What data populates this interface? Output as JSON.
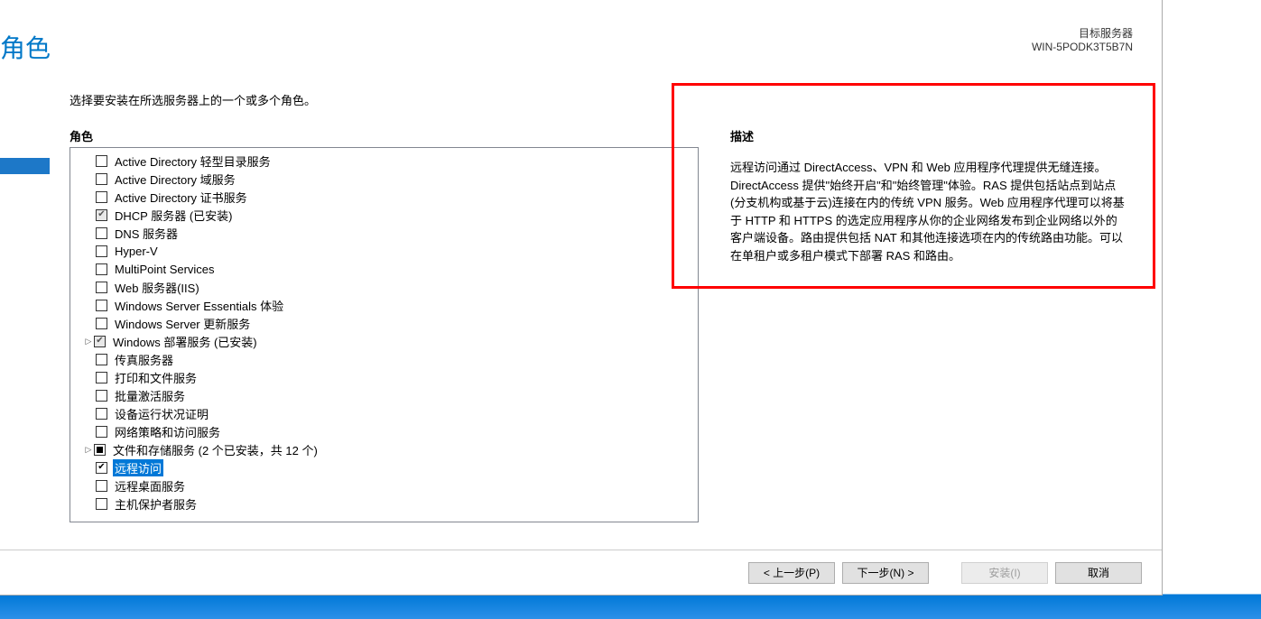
{
  "header": {
    "partial_title": "角色",
    "target_server_label": "目标服务器",
    "target_server_name": "WIN-5PODK3T5B7N"
  },
  "instruction": "选择要安装在所选服务器上的一个或多个角色。",
  "roles_label": "角色",
  "roles": [
    {
      "label": "Active Directory 轻型目录服务",
      "state": "unchecked",
      "expandable": false
    },
    {
      "label": "Active Directory 域服务",
      "state": "unchecked",
      "expandable": false
    },
    {
      "label": "Active Directory 证书服务",
      "state": "unchecked",
      "expandable": false
    },
    {
      "label": "DHCP 服务器 (已安装)",
      "state": "checked-locked",
      "expandable": false
    },
    {
      "label": "DNS 服务器",
      "state": "unchecked",
      "expandable": false
    },
    {
      "label": "Hyper-V",
      "state": "unchecked",
      "expandable": false
    },
    {
      "label": "MultiPoint Services",
      "state": "unchecked",
      "expandable": false
    },
    {
      "label": "Web 服务器(IIS)",
      "state": "unchecked",
      "expandable": false
    },
    {
      "label": "Windows Server Essentials 体验",
      "state": "unchecked",
      "expandable": false
    },
    {
      "label": "Windows Server 更新服务",
      "state": "unchecked",
      "expandable": false
    },
    {
      "label": "Windows 部署服务 (已安装)",
      "state": "checked-locked",
      "expandable": true
    },
    {
      "label": "传真服务器",
      "state": "unchecked",
      "expandable": false
    },
    {
      "label": "打印和文件服务",
      "state": "unchecked",
      "expandable": false
    },
    {
      "label": "批量激活服务",
      "state": "unchecked",
      "expandable": false
    },
    {
      "label": "设备运行状况证明",
      "state": "unchecked",
      "expandable": false
    },
    {
      "label": "网络策略和访问服务",
      "state": "unchecked",
      "expandable": false
    },
    {
      "label": "文件和存储服务 (2 个已安装，共 12 个)",
      "state": "partial",
      "expandable": true
    },
    {
      "label": "远程访问",
      "state": "checked",
      "expandable": false,
      "selected": true
    },
    {
      "label": "远程桌面服务",
      "state": "unchecked",
      "expandable": false
    },
    {
      "label": "主机保护者服务",
      "state": "unchecked",
      "expandable": false
    }
  ],
  "description": {
    "title": "描述",
    "text": "远程访问通过 DirectAccess、VPN 和 Web 应用程序代理提供无缝连接。DirectAccess 提供\"始终开启\"和\"始终管理\"体验。RAS 提供包括站点到站点(分支机构或基于云)连接在内的传统 VPN 服务。Web 应用程序代理可以将基于 HTTP 和 HTTPS 的选定应用程序从你的企业网络发布到企业网络以外的客户端设备。路由提供包括 NAT 和其他连接选项在内的传统路由功能。可以在单租户或多租户模式下部署 RAS 和路由。"
  },
  "buttons": {
    "prev": "< 上一步(P)",
    "next": "下一步(N) >",
    "install": "安装(I)",
    "cancel": "取消"
  }
}
